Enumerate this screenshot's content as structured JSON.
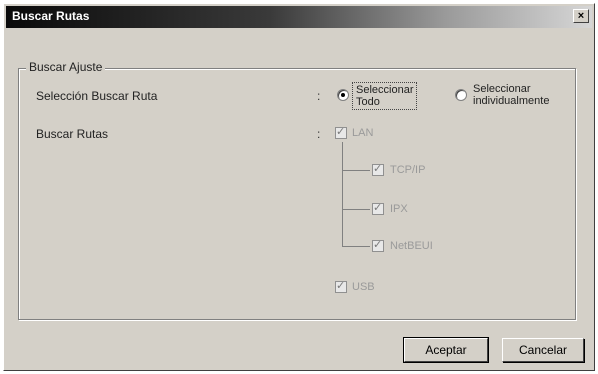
{
  "window": {
    "title": "Buscar Rutas",
    "close_glyph": "×"
  },
  "group": {
    "label": "Buscar Ajuste"
  },
  "route_search_selection": {
    "label": "Selección Buscar Ruta",
    "colon": ":",
    "options": [
      {
        "label_line1": "Seleccionar",
        "label_line2": "Todo",
        "checked": true
      },
      {
        "label_line1": "Seleccionar",
        "label_line2": "individualmente",
        "checked": false
      }
    ]
  },
  "search_routes": {
    "label": "Buscar Rutas",
    "colon": ":",
    "lan": {
      "label": "LAN",
      "checked": true,
      "enabled": false
    },
    "protocols": [
      {
        "label": "TCP/IP",
        "checked": true
      },
      {
        "label": "IPX",
        "checked": true
      },
      {
        "label": "NetBEUI",
        "checked": true
      }
    ],
    "usb": {
      "label": "USB",
      "checked": true,
      "enabled": false
    }
  },
  "buttons": {
    "accept": "Aceptar",
    "cancel": "Cancelar"
  }
}
